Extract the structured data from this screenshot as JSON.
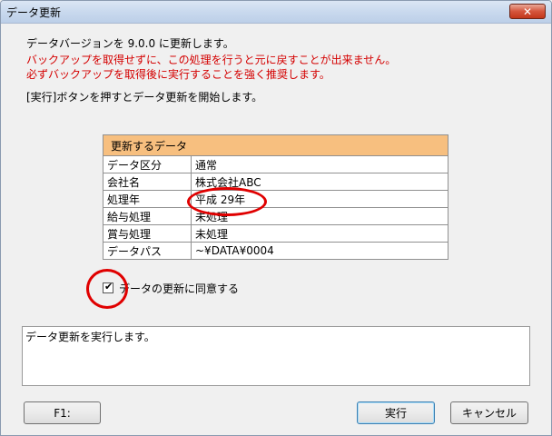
{
  "window": {
    "title": "データ更新",
    "close_label": "✕"
  },
  "messages": {
    "line1": "データバージョンを 9.0.0 に更新します。",
    "warning1": "バックアップを取得せずに、この処理を行うと元に戻すことが出来ません。",
    "warning2": "必ずバックアップを取得後に実行することを強く推奨します。",
    "instruction": "[実行]ボタンを押すとデータ更新を開始します。"
  },
  "table": {
    "header": "更新するデータ",
    "rows": [
      {
        "label": "データ区分",
        "value": "通常"
      },
      {
        "label": "会社名",
        "value": "株式会社ABC"
      },
      {
        "label": "処理年",
        "value": "平成 29年"
      },
      {
        "label": "給与処理",
        "value": "未処理"
      },
      {
        "label": "賞与処理",
        "value": "未処理"
      },
      {
        "label": "データパス",
        "value": "~¥DATA¥0004"
      }
    ]
  },
  "agree": {
    "checked": true,
    "label": "データの更新に同意する"
  },
  "log": {
    "text": "データ更新を実行します。"
  },
  "buttons": {
    "f1": "F1:",
    "execute": "実行",
    "cancel": "キャンセル"
  },
  "colors": {
    "table_header_bg": "#f7bf7f",
    "warning_text": "#d40000",
    "annotation": "#e00000"
  }
}
